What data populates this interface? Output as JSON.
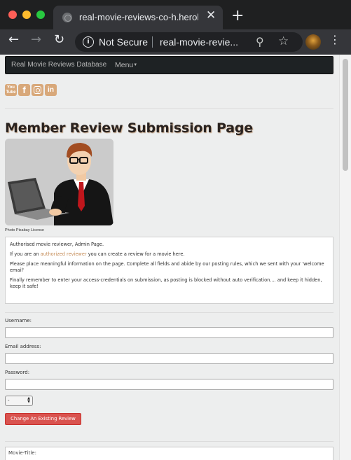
{
  "browser": {
    "tab_title": "real-movie-reviews-co-h.herokuapp",
    "tab_close": "✕",
    "new_tab": "+",
    "security_label": "Not Secure",
    "url": "real-movie-revie...",
    "icons": [
      "back-icon",
      "forward-icon",
      "reload-icon",
      "info-icon",
      "zoom-icon",
      "star-icon",
      "profile-avatar",
      "menu-icon"
    ]
  },
  "site": {
    "brand": "Real Movie Reviews Database",
    "menu": "Menu",
    "social_icons": [
      "youtube-icon",
      "facebook-icon",
      "instagram-icon",
      "linkedin-icon"
    ],
    "social_labels": {
      "youtube": "You Tube",
      "facebook": "f",
      "linkedin": "in"
    }
  },
  "page": {
    "title": "Member Review Submission Page",
    "photo_caption": "Photo Pixabay License",
    "info": {
      "line1": "Authorised movie reviewer, Admin Page.",
      "line2_before": "If you are an ",
      "line2_link": "authorized reviewer",
      "line2_after": " you can create a review for a movie here.",
      "line3": "Please place meaningful information on the page. Complete all fields and abide by our posting rules, which we sent with your 'welcome email'",
      "line4": "Finally remember to enter your access-credentials on submission, as posting is blocked without auto verification.... and keep it hidden, keep it safe!"
    },
    "form": {
      "username_label": "Username:",
      "username_value": "",
      "email_label": "Email address:",
      "email_value": "",
      "password_label": "Password:",
      "password_value": "",
      "select_value": "-",
      "change_button": "Change An Existing Review",
      "movie_title_label": "Movie-Title:"
    }
  },
  "colors": {
    "accent": "#c48a54",
    "social": "#d8a87a",
    "button_red": "#d9534f",
    "nav_bg": "#1e2224",
    "page_bg": "#edeeee"
  }
}
